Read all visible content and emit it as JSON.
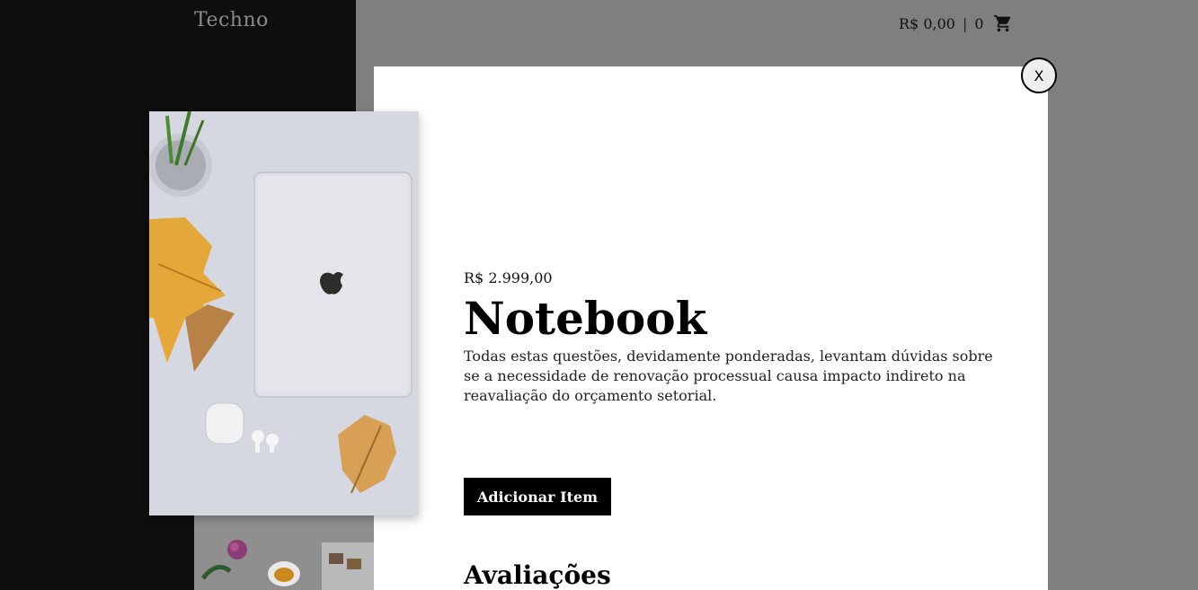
{
  "header": {
    "logo": "Techno",
    "cart_total": "R$ 0,00",
    "cart_separator": "|",
    "cart_count": "0"
  },
  "modal": {
    "close_label": "X",
    "price": "R$ 2.999,00",
    "title": "Notebook",
    "description": "Todas estas questões, devidamente ponderadas, levantam dúvidas sobre se a necessidade de renovação processual causa impacto indireto na reavaliação do orçamento setorial.",
    "add_button_label": "Adicionar Item",
    "reviews_heading": "Avaliações"
  },
  "colors": {
    "sidebar": "#0e0e0e",
    "overlay": "#808080",
    "button": "#000000"
  }
}
